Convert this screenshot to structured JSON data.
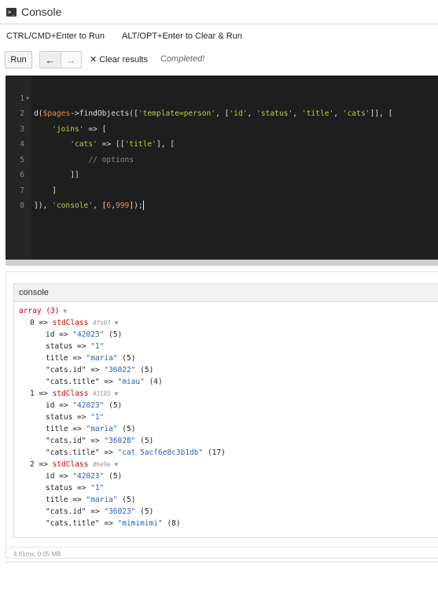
{
  "window": {
    "title": "Console",
    "icon": "terminal-icon"
  },
  "hints": {
    "run": "CTRL/CMD+Enter to Run",
    "clear": "ALT/OPT+Enter to Clear & Run"
  },
  "toolbar": {
    "run_label": "Run",
    "back_icon": "←",
    "forward_icon": "→",
    "clear_label": "Clear results",
    "status": "Completed!"
  },
  "editor": {
    "lines": [
      {
        "n": "1",
        "fold": "▼"
      },
      {
        "n": "2",
        "fold": ""
      },
      {
        "n": "3",
        "fold": ""
      },
      {
        "n": "4",
        "fold": ""
      },
      {
        "n": "5",
        "fold": ""
      },
      {
        "n": "6",
        "fold": ""
      },
      {
        "n": "7",
        "fold": ""
      },
      {
        "n": "8",
        "fold": ""
      }
    ]
  },
  "console": {
    "header": "console",
    "array_label": "array (3)",
    "items": [
      {
        "index": "0 => ",
        "class": "stdClass",
        "hash": "#fb0f",
        "props": [
          {
            "k": "id => ",
            "v": "\"42023\"",
            "len": " (5)"
          },
          {
            "k": "status => ",
            "v": "\"1\"",
            "len": ""
          },
          {
            "k": "title => ",
            "v": "\"maria\"",
            "len": " (5)"
          },
          {
            "k": "\"cats.id\" => ",
            "v": "\"36022\"",
            "len": " (5)"
          },
          {
            "k": "\"cats.title\" => ",
            "v": "\"miau\"",
            "len": " (4)"
          }
        ]
      },
      {
        "index": "1 => ",
        "class": "stdClass",
        "hash": "#3185",
        "props": [
          {
            "k": "id => ",
            "v": "\"42023\"",
            "len": " (5)"
          },
          {
            "k": "status => ",
            "v": "\"1\"",
            "len": ""
          },
          {
            "k": "title => ",
            "v": "\"maria\"",
            "len": " (5)"
          },
          {
            "k": "\"cats.id\" => ",
            "v": "\"36028\"",
            "len": " (5)"
          },
          {
            "k": "\"cats.title\" => ",
            "v": "\"cat 5acf6e8c3b1db\"",
            "len": " (17)"
          }
        ]
      },
      {
        "index": "2 => ",
        "class": "stdClass",
        "hash": "#6e9e",
        "props": [
          {
            "k": "id => ",
            "v": "\"42023\"",
            "len": " (5)"
          },
          {
            "k": "status => ",
            "v": "\"1\"",
            "len": ""
          },
          {
            "k": "title => ",
            "v": "\"maria\"",
            "len": " (5)"
          },
          {
            "k": "\"cats.id\" => ",
            "v": "\"36023\"",
            "len": " (5)"
          },
          {
            "k": "\"cats.title\" => ",
            "v": "\"mimimimi\"",
            "len": " (8)"
          }
        ]
      }
    ]
  },
  "timing": "4.81ms, 0.05 MB"
}
